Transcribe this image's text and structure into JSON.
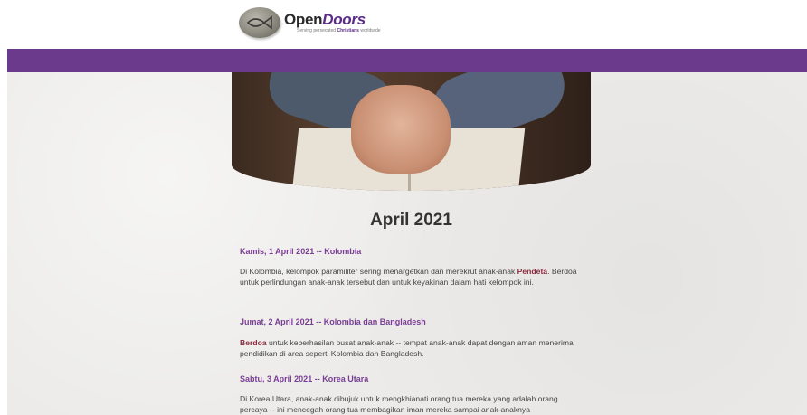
{
  "brand": {
    "name_first": "Open",
    "name_second": "Doors",
    "tagline_before": "Serving persecuted ",
    "tagline_bold": "Christians",
    "tagline_after": " worldwide"
  },
  "colors": {
    "purple_bar": "#6c3a8d",
    "heading": "#7a3d94",
    "highlight": "#8b2a3e"
  },
  "hero": {
    "image": "praying-hands-over-bible"
  },
  "page": {
    "month_title": "April 2021"
  },
  "entries": [
    {
      "heading": "Kamis, 1 April 2021 -- Kolombia",
      "body_a": "Di Kolombia, kelompok paramiliter sering menargetkan dan merekrut anak-anak ",
      "body_hl": "Pendeta",
      "body_b": ". Berdoa untuk perlindungan anak-anak tersebut dan untuk keyakinan dalam hati kelompok ini."
    },
    {
      "heading": "Jumat, 2 April 2021 -- Kolombia dan Bangladesh",
      "body_hl": "Berdoa",
      "body_b": " untuk keberhasilan pusat anak-anak -- tempat anak-anak dapat dengan aman menerima pendidikan di area seperti Kolombia dan Bangladesh."
    },
    {
      "heading": "Sabtu, 3 April 2021 -- Korea Utara",
      "body_a": "Di Korea Utara, anak-anak dibujuk untuk mengkhianati orang tua mereka yang adalah orang percaya -- ini mencegah orang tua membagikan iman mereka sampai anak-anaknya"
    }
  ]
}
